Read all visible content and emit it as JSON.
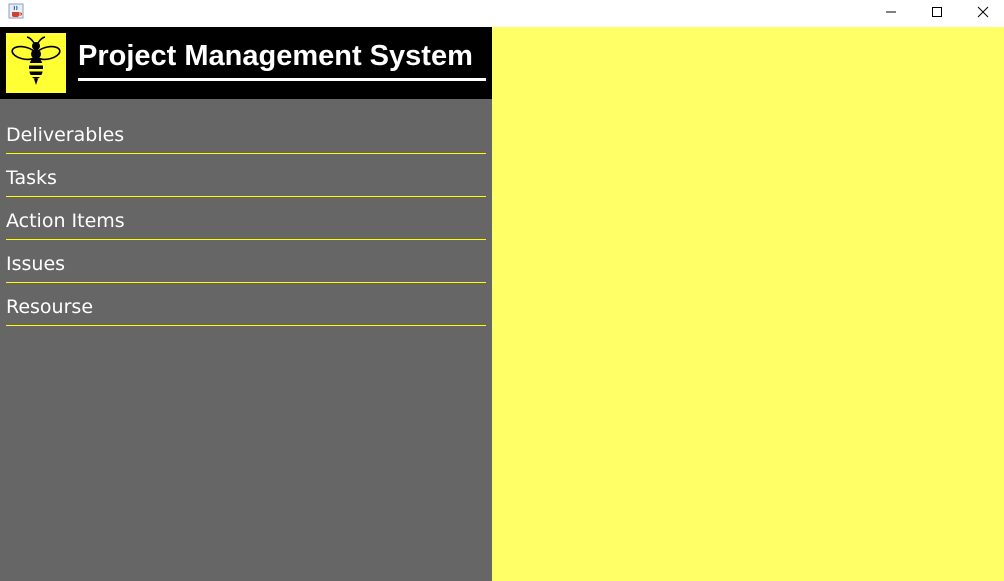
{
  "window": {
    "icon": "java-cup-icon",
    "controls": [
      "minimize-icon",
      "maximize-icon",
      "close-icon"
    ]
  },
  "header": {
    "title": "Project Management System",
    "logo_icon": "bee-icon"
  },
  "sidebar": {
    "items": [
      {
        "label": "Deliverables"
      },
      {
        "label": "Tasks"
      },
      {
        "label": "Action Items"
      },
      {
        "label": "Issues"
      },
      {
        "label": "Resourse"
      }
    ]
  },
  "colors": {
    "header_bg": "#000000",
    "sidebar_bg": "#666666",
    "accent": "#ffff00",
    "content_bg": "#ffff66",
    "logo_bg": "#ffff33"
  }
}
